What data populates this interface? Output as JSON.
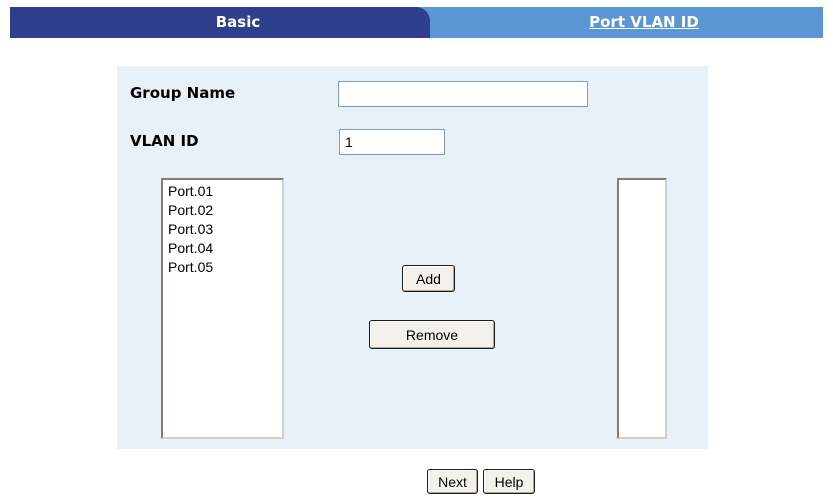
{
  "tabs": {
    "basic_label": "Basic",
    "port_vlan_label": "Port VLAN ID"
  },
  "form": {
    "group_name_label": "Group Name",
    "group_name_value": "",
    "vlan_id_label": "VLAN ID",
    "vlan_id_value": "1"
  },
  "ports": {
    "available": [
      "Port.01",
      "Port.02",
      "Port.03",
      "Port.04",
      "Port.05"
    ],
    "members": []
  },
  "buttons": {
    "add": "Add",
    "remove": "Remove",
    "next": "Next",
    "help": "Help"
  },
  "colors": {
    "tab_active": "#2e3f8e",
    "tab_inactive": "#5b95d4",
    "panel_bg": "#e8f0f8"
  }
}
